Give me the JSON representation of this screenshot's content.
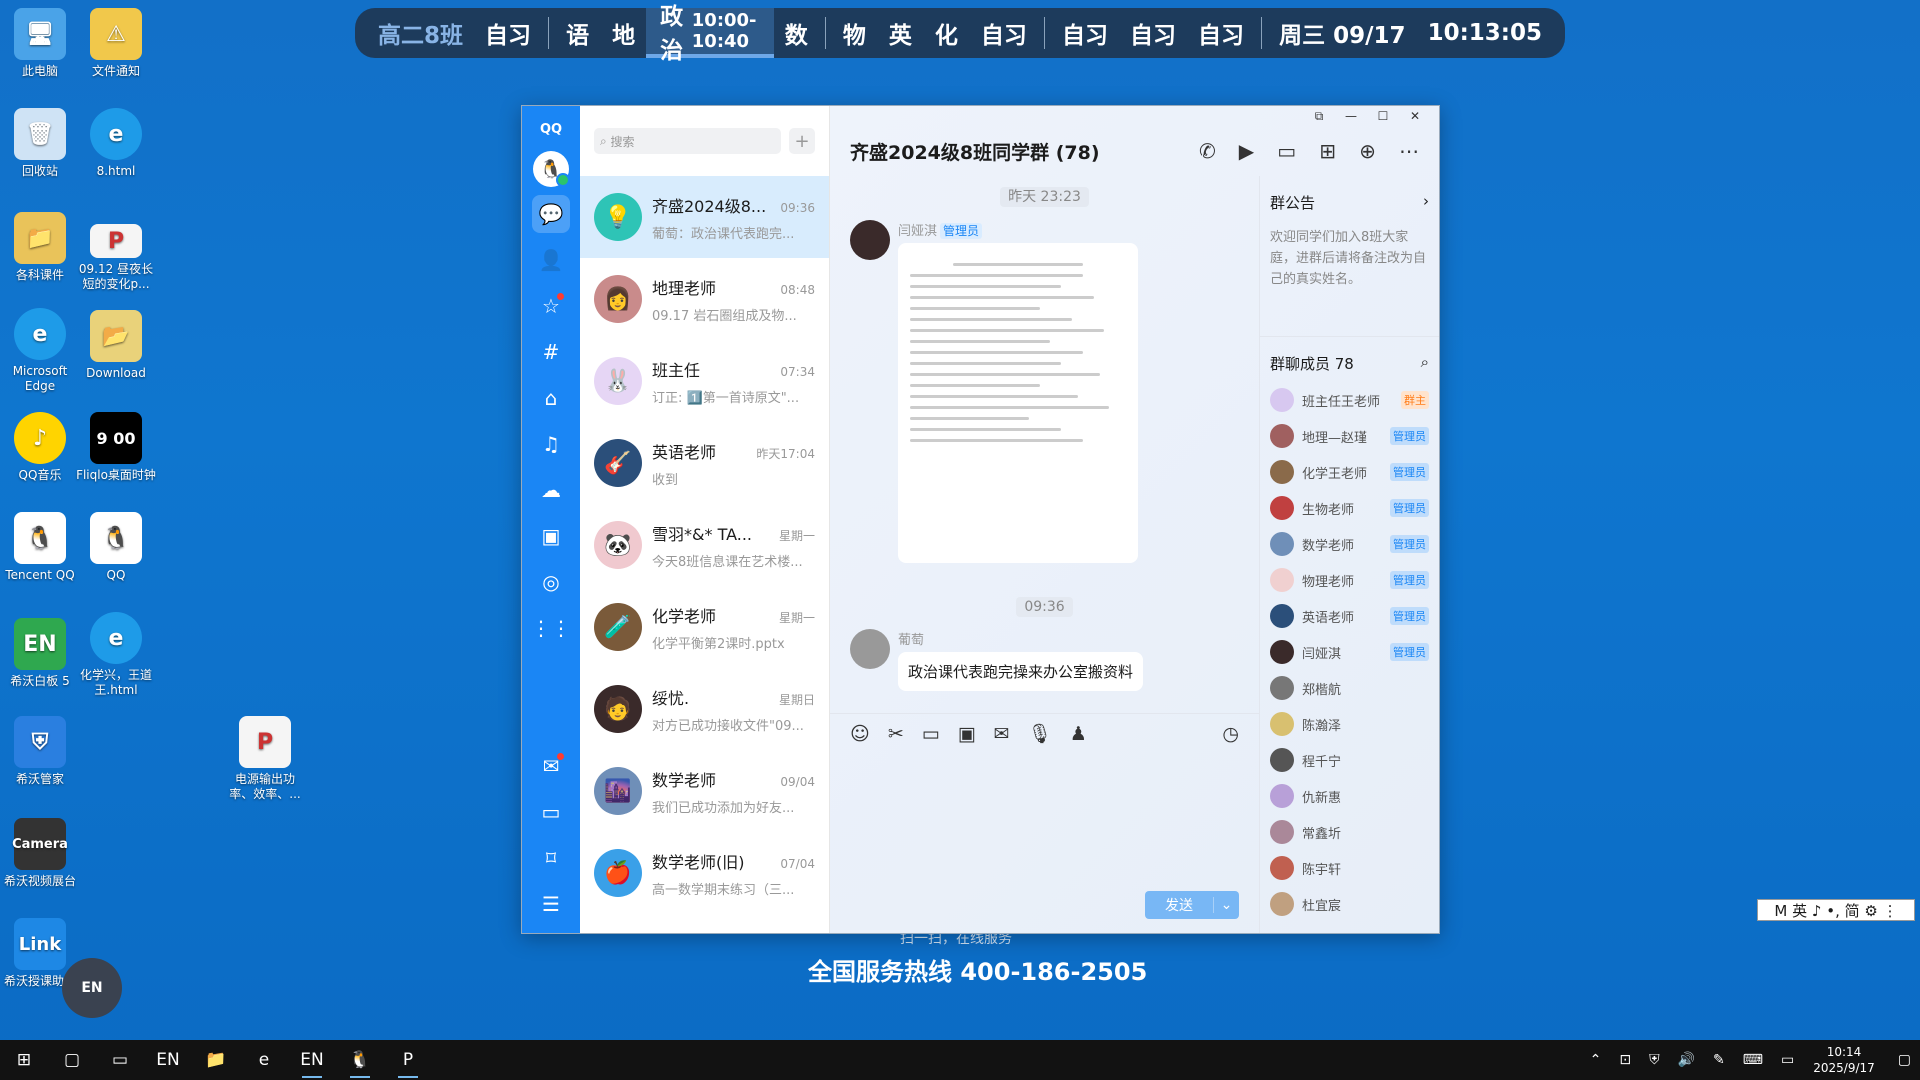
{
  "desktop": {
    "icons": [
      {
        "label": "此电脑"
      },
      {
        "label": "文件通知"
      },
      {
        "label": "回收站"
      },
      {
        "label": "8.html"
      },
      {
        "label": "各科课件"
      },
      {
        "label": "09.12 昼夜长短的变化p..."
      },
      {
        "label": "Microsoft Edge"
      },
      {
        "label": "Download"
      },
      {
        "label": "QQ音乐"
      },
      {
        "label": "Fliqlo桌面时钟"
      },
      {
        "label": "Tencent QQ"
      },
      {
        "label": "QQ"
      },
      {
        "label": "希沃白板 5"
      },
      {
        "label": "化学兴，王道王.html"
      },
      {
        "label": "希沃管家"
      },
      {
        "label": "电源输出功率、效率、..."
      },
      {
        "label": "希沃视频展台"
      },
      {
        "label": "希沃授课助手"
      }
    ],
    "hotline_sub": "扫一扫，在线服务",
    "hotline": "全国服务热线 400-186-2505",
    "floating_button": "EN"
  },
  "schedule": {
    "class": "高二8班",
    "slot1": "自习",
    "subjects_a": "语　地",
    "active_subject": "政治",
    "active_time": "10:00-10:40",
    "subject_b": "数",
    "subjects_c": "物　英　化　自习",
    "slot_x1": "自习",
    "slot_x2": "自习",
    "slot_x3": "自习",
    "date": "周三 09/17",
    "time": "10:13:05"
  },
  "qq": {
    "brand": "QQ",
    "search_placeholder": "搜索",
    "chats": [
      {
        "name": "齐盛2024级8...",
        "time": "09:36",
        "msg": "葡萄：政治课代表跑完...",
        "color": "#2ec4b6",
        "icon": "💡"
      },
      {
        "name": "地理老师",
        "time": "08:48",
        "msg": "09.17 岩石圈组成及物...",
        "color": "#c98b8b",
        "icon": "👩"
      },
      {
        "name": "班主任",
        "time": "07:34",
        "msg": "订正: 1️⃣第一首诗原文\"...",
        "color": "#e6d6f5",
        "icon": "🐰"
      },
      {
        "name": "英语老师",
        "time": "昨天17:04",
        "msg": "收到",
        "color": "#2b4f7a",
        "icon": "🎸"
      },
      {
        "name": "雪羽*&* TA...",
        "time": "星期一",
        "msg": "今天8班信息课在艺术楼...",
        "color": "#f0c9cf",
        "icon": "🐼"
      },
      {
        "name": "化学老师",
        "time": "星期一",
        "msg": "化学平衡第2课时.pptx",
        "color": "#7a5a3a",
        "icon": "🧪"
      },
      {
        "name": "绥忧.",
        "time": "星期日",
        "msg": "对方已成功接收文件\"09...",
        "color": "#3a2a2a",
        "icon": "🧑"
      },
      {
        "name": "数学老师",
        "time": "09/04",
        "msg": "我们已成功添加为好友...",
        "color": "#6f8fb8",
        "icon": "🌆"
      },
      {
        "name": "数学老师(旧)",
        "time": "07/04",
        "msg": "高一数学期末练习（三...",
        "color": "#3aa0e8",
        "icon": "🍎"
      }
    ],
    "chat": {
      "title": "齐盛2024级8班同学群 (78)",
      "ts1": "昨天 23:23",
      "sender1": "闫娅淇",
      "sender1_badge": "管理员",
      "ts2": "09:36",
      "sender2": "葡萄",
      "bubble2": "政治课代表跑完操来办公室搬资料",
      "send": "发送"
    },
    "side": {
      "notice_title": "群公告",
      "notice": "欢迎同学们加入8班大家庭，进群后请将备注改为自己的真实姓名。",
      "members_title": "群聊成员 78",
      "members": [
        {
          "name": "班主任王老师",
          "tag": "群主",
          "kind": "owner",
          "color": "#d7c8f0"
        },
        {
          "name": "地理—赵瑾",
          "tag": "管理员",
          "kind": "admin",
          "color": "#a06060"
        },
        {
          "name": "化学王老师",
          "tag": "管理员",
          "kind": "admin",
          "color": "#8a6a4a"
        },
        {
          "name": "生物老师",
          "tag": "管理员",
          "kind": "admin",
          "color": "#c04040"
        },
        {
          "name": "数学老师",
          "tag": "管理员",
          "kind": "admin",
          "color": "#6f8fb8"
        },
        {
          "name": "物理老师",
          "tag": "管理员",
          "kind": "admin",
          "color": "#f0d0d0"
        },
        {
          "name": "英语老师",
          "tag": "管理员",
          "kind": "admin",
          "color": "#2b4f7a"
        },
        {
          "name": "闫娅淇",
          "tag": "管理员",
          "kind": "admin",
          "color": "#3a2a2a"
        },
        {
          "name": "郑楷航",
          "tag": "",
          "kind": "",
          "color": "#777"
        },
        {
          "name": "陈瀚泽",
          "tag": "",
          "kind": "",
          "color": "#d8c070"
        },
        {
          "name": "程千宁",
          "tag": "",
          "kind": "",
          "color": "#555"
        },
        {
          "name": "仇新惠",
          "tag": "",
          "kind": "",
          "color": "#b8a0d8"
        },
        {
          "name": "常鑫圻",
          "tag": "",
          "kind": "",
          "color": "#aa8899"
        },
        {
          "name": "陈宇轩",
          "tag": "",
          "kind": "",
          "color": "#c06050"
        },
        {
          "name": "杜宜宸",
          "tag": "",
          "kind": "",
          "color": "#c0a080"
        }
      ]
    }
  },
  "ime": "M 英 ♪ •, 简 ⚙ ⋮",
  "taskbar": {
    "time": "10:14",
    "date": "2025/9/17"
  }
}
